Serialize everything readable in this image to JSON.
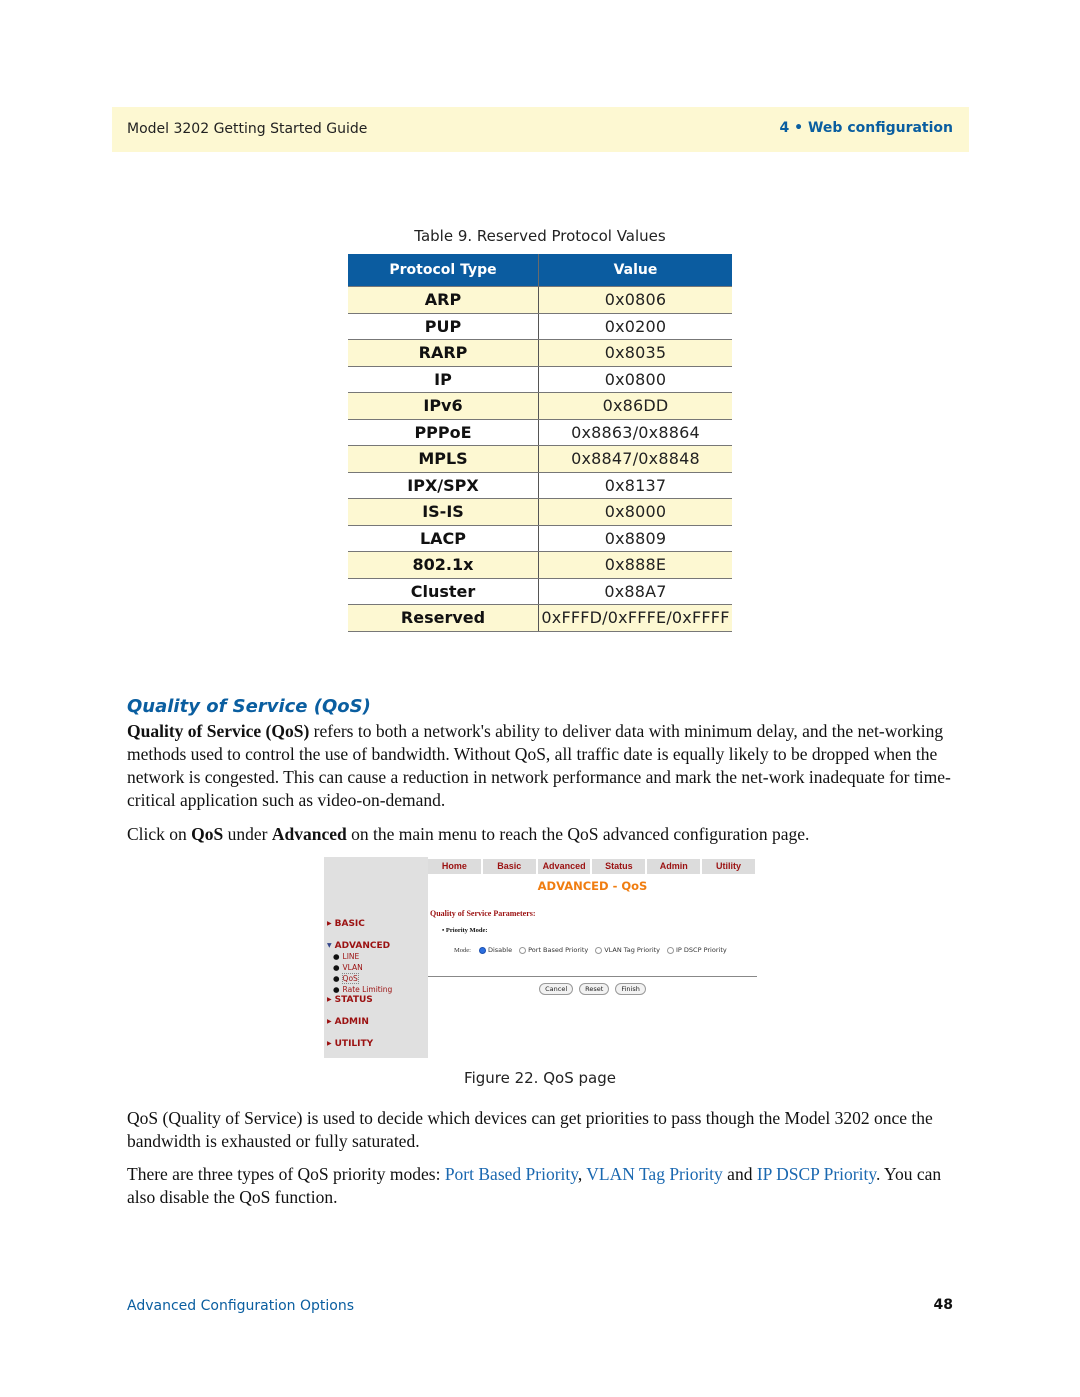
{
  "header": {
    "guide_title": "Model 3202 Getting Started Guide",
    "chapter": "4 • Web configuration"
  },
  "table": {
    "caption": "Table 9. Reserved Protocol Values",
    "columns": [
      "Protocol Type",
      "Value"
    ],
    "rows": [
      {
        "type": "ARP",
        "value": "0x0806"
      },
      {
        "type": "PUP",
        "value": "0x0200"
      },
      {
        "type": "RARP",
        "value": "0x8035"
      },
      {
        "type": "IP",
        "value": "0x0800"
      },
      {
        "type": "IPv6",
        "value": "0x86DD"
      },
      {
        "type": "PPPoE",
        "value": "0x8863/0x8864"
      },
      {
        "type": "MPLS",
        "value": "0x8847/0x8848"
      },
      {
        "type": "IPX/SPX",
        "value": "0x8137"
      },
      {
        "type": "IS-IS",
        "value": "0x8000"
      },
      {
        "type": "LACP",
        "value": "0x8809"
      },
      {
        "type": "802.1x",
        "value": "0x888E"
      },
      {
        "type": "Cluster",
        "value": "0x88A7"
      },
      {
        "type": "Reserved",
        "value": "0xFFFD/0xFFFE/0xFFFF"
      }
    ]
  },
  "section": {
    "title": "Quality of Service (QoS)",
    "p1_bold": "Quality of Service",
    "p1_paren": "(QoS)",
    "p1_rest": " refers to both a network's ability to deliver data with minimum delay, and the net-working methods used to control the use of bandwidth. Without QoS, all traffic date is equally likely to be dropped when the network is congested. This can cause a reduction in network performance and mark the net-work inadequate for time-critical application such as video-on-demand.",
    "p2_a": "Click on ",
    "p2_b": "QoS",
    "p2_c": " under ",
    "p2_d": "Advanced",
    "p2_e": " on the main menu to reach the QoS advanced configuration page.",
    "p3": "QoS (Quality of Service) is used to decide which devices can get priorities to pass though the Model 3202 once the bandwidth is exhausted or fully saturated.",
    "p4_a": "There are three types of QoS priority modes: ",
    "p4_link1": "Port Based Priority",
    "p4_b": ", ",
    "p4_link2": "VLAN Tag Priority",
    "p4_c": " and ",
    "p4_link3": "IP DSCP Priority",
    "p4_d": ". You can also disable the QoS function."
  },
  "figure": {
    "caption": "Figure 22. QoS page",
    "nav": [
      "Home",
      "Basic",
      "Advanced",
      "Status",
      "Admin",
      "Utility"
    ],
    "page_title": "ADVANCED - QoS",
    "sidebar": {
      "basic": "BASIC",
      "advanced": "ADVANCED",
      "sub": [
        "LINE",
        "VLAN",
        "QoS",
        "Rate Limiting"
      ],
      "status": "STATUS",
      "admin": "ADMIN",
      "utility": "UTILITY"
    },
    "params_heading": "Quality of Service Parameters:",
    "priority_mode_label": "Priority Mode:",
    "mode_label": "Mode:",
    "mode_options": [
      "Disable",
      "Port Based Priority",
      "VLAN Tag Priority",
      "IP DSCP Priority"
    ],
    "mode_selected": "Disable",
    "buttons": [
      "Cancel",
      "Reset",
      "Finish"
    ]
  },
  "footer": {
    "section_name": "Advanced Configuration Options",
    "page_number": "48"
  }
}
